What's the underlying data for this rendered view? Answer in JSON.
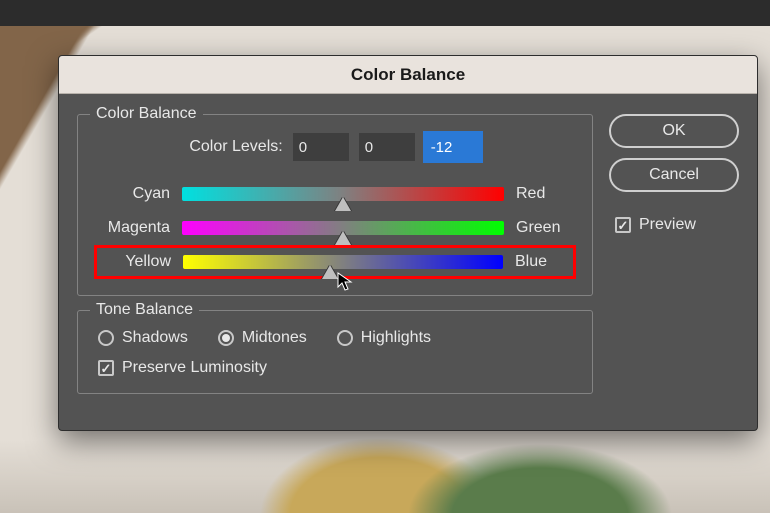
{
  "dialog": {
    "title": "Color Balance",
    "color_balance": {
      "legend": "Color Balance",
      "levels_label": "Color Levels:",
      "levels": [
        "0",
        "0",
        "-12"
      ],
      "sliders": [
        {
          "left": "Cyan",
          "right": "Red",
          "value_pct": 50
        },
        {
          "left": "Magenta",
          "right": "Green",
          "value_pct": 50
        },
        {
          "left": "Yellow",
          "right": "Blue",
          "value_pct": 46
        }
      ]
    },
    "tone_balance": {
      "legend": "Tone Balance",
      "options": [
        "Shadows",
        "Midtones",
        "Highlights"
      ],
      "selected": "Midtones",
      "preserve_label": "Preserve Luminosity",
      "preserve_checked": true
    },
    "buttons": {
      "ok": "OK",
      "cancel": "Cancel"
    },
    "preview": {
      "label": "Preview",
      "checked": true
    }
  }
}
